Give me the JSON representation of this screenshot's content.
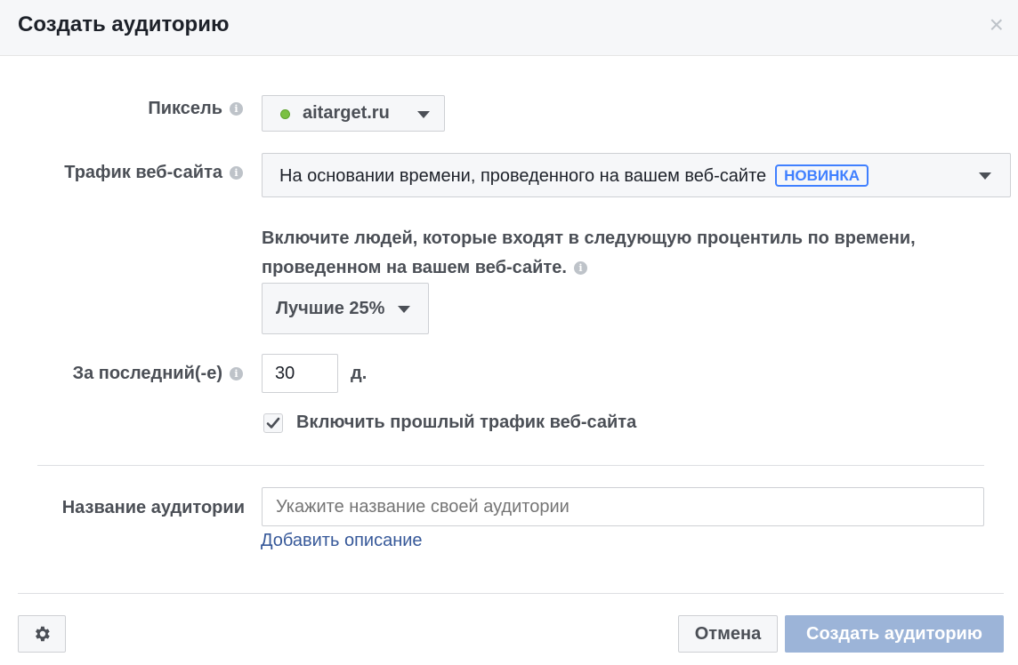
{
  "dialog": {
    "title": "Создать аудиторию",
    "close_glyph": "×"
  },
  "pixel": {
    "label": "Пиксель",
    "selected": "aitarget.ru",
    "status_color": "#7bc043"
  },
  "traffic": {
    "label": "Трафик веб-сайта",
    "selected": "На основании времени, проведенного на вашем веб-сайте",
    "badge": "НОВИНКА"
  },
  "percentile": {
    "description": "Включите людей, которые входят в следующую процентиль по времени, проведенном на вашем веб-сайте.",
    "selected": "Лучшие 25%"
  },
  "period": {
    "label": "За последний(-е)",
    "value": "30",
    "unit": "д."
  },
  "past_traffic": {
    "label": "Включить прошлый трафик веб-сайта",
    "checked": true
  },
  "audience_name": {
    "label": "Название аудитории",
    "placeholder": "Укажите название своей аудитории",
    "value": "",
    "add_description": "Добавить описание"
  },
  "footer": {
    "cancel_label": "Отмена",
    "create_label": "Создать аудиторию",
    "create_color": "#9cb4d8"
  },
  "icons": {
    "info": "info-icon",
    "settings": "gear-icon",
    "close": "close-icon",
    "checkmark": "checkmark-icon",
    "caret": "caret-down-icon"
  }
}
